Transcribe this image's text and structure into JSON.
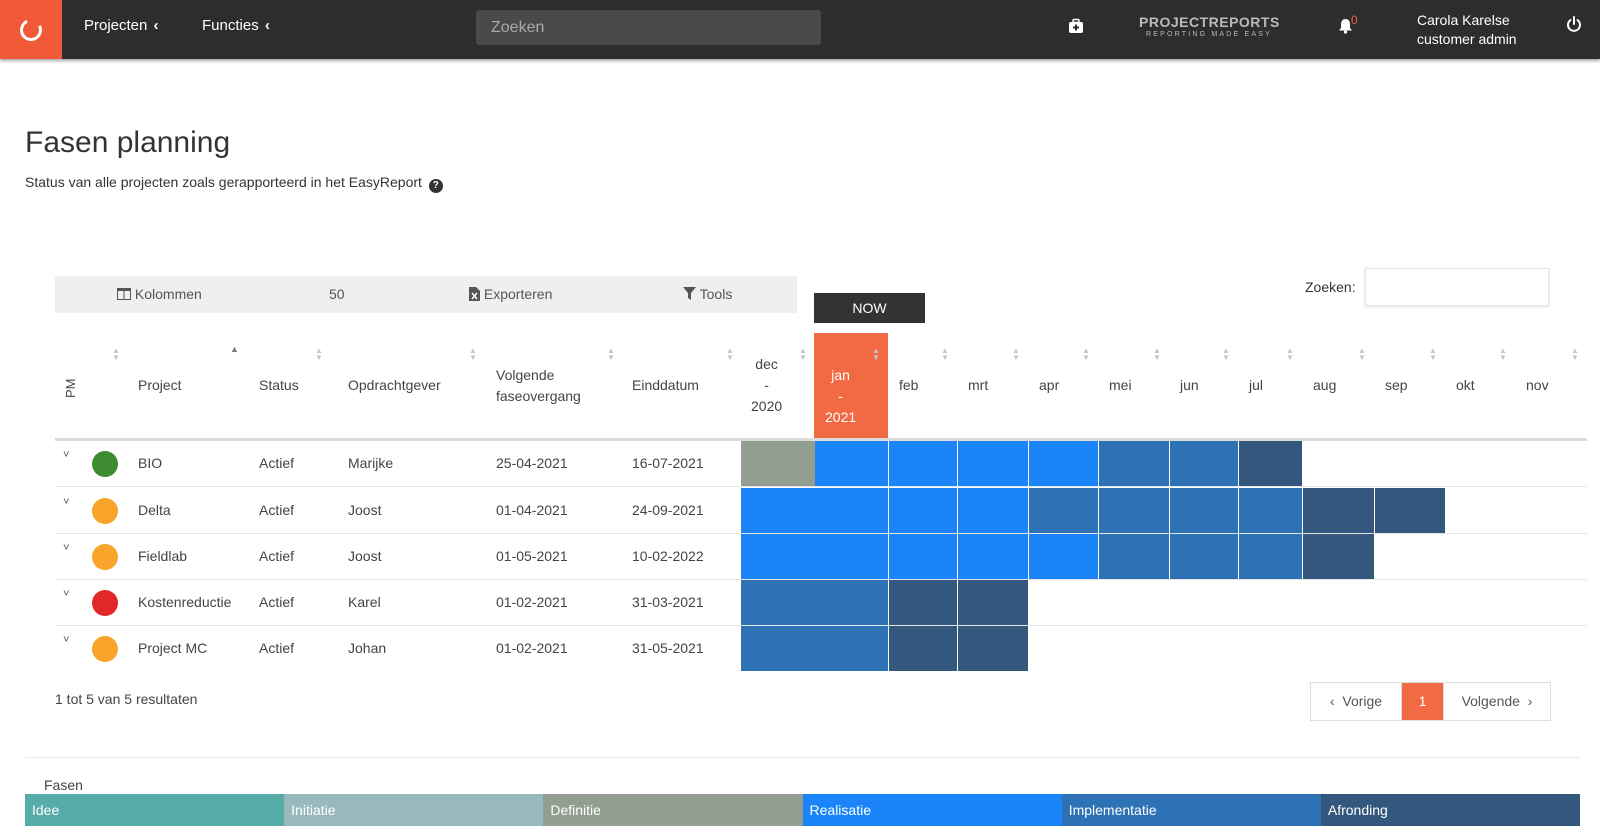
{
  "nav": {
    "projects": "Projecten",
    "functions": "Functies",
    "chevron": "‹",
    "search_placeholder": "Zoeken",
    "brand_main": "PROJECTREPORTS",
    "brand_sub": "REPORTING MADE EASY",
    "notification_count": "0",
    "user_name": "Carola Karelse",
    "user_role": "customer admin"
  },
  "page": {
    "title": "Fasen planning",
    "subtitle": "Status van alle projecten zoals gerapporteerd in het EasyReport"
  },
  "toolbar": {
    "columns": "Kolommen",
    "page_length": "50",
    "export": "Exporteren",
    "tools": "Tools"
  },
  "now_label": "NOW",
  "search_label": "Zoeken:",
  "table": {
    "headers": {
      "pm": "PM",
      "project": "Project",
      "status": "Status",
      "client": "Opdrachtgever",
      "next_transition": "Volgende faseovergang",
      "end_date": "Einddatum"
    },
    "months": [
      "dec - 2020",
      "jan - 2021",
      "feb",
      "mrt",
      "apr",
      "mei",
      "jun",
      "jul",
      "aug",
      "sep",
      "okt",
      "nov"
    ],
    "rows": [
      {
        "pm_color": "#3d8a30",
        "project": "BIO",
        "status": "Actief",
        "client": "Marijke",
        "next": "25-04-2021",
        "end": "16-07-2021",
        "phases": [
          "Definitie",
          "Realisatie",
          "Realisatie",
          "Realisatie",
          "Realisatie",
          "Implementatie",
          "Implementatie",
          "Afronding",
          "",
          "",
          "",
          ""
        ]
      },
      {
        "pm_color": "#f9a42a",
        "project": "Delta",
        "status": "Actief",
        "client": "Joost",
        "next": "01-04-2021",
        "end": "24-09-2021",
        "phases": [
          "Realisatie",
          "Realisatie",
          "Realisatie",
          "Realisatie",
          "Implementatie",
          "Implementatie",
          "Implementatie",
          "Implementatie",
          "Afronding",
          "Afronding",
          "",
          ""
        ]
      },
      {
        "pm_color": "#f9a42a",
        "project": "Fieldlab",
        "status": "Actief",
        "client": "Joost",
        "next": "01-05-2021",
        "end": "10-02-2022",
        "phases": [
          "Realisatie",
          "Realisatie",
          "Realisatie",
          "Realisatie",
          "Realisatie",
          "Implementatie",
          "Implementatie",
          "Implementatie",
          "Afronding",
          "",
          "",
          ""
        ]
      },
      {
        "pm_color": "#e02828",
        "project": "Kostenreductie",
        "status": "Actief",
        "client": "Karel",
        "next": "01-02-2021",
        "end": "31-03-2021",
        "phases": [
          "Implementatie",
          "Implementatie",
          "Afronding",
          "Afronding",
          "",
          "",
          "",
          "",
          "",
          "",
          "",
          ""
        ]
      },
      {
        "pm_color": "#f9a42a",
        "project": "Project MC",
        "status": "Actief",
        "client": "Johan",
        "next": "01-02-2021",
        "end": "31-05-2021",
        "phases": [
          "Implementatie",
          "Implementatie",
          "Afronding",
          "Afronding",
          "",
          "",
          "",
          "",
          "",
          "",
          "",
          ""
        ]
      }
    ]
  },
  "results": "1 tot 5 van 5 resultaten",
  "pager": {
    "prev": "Vorige",
    "current": "1",
    "next": "Volgende"
  },
  "legend": {
    "title": "Fasen",
    "phases": [
      {
        "name": "Idee",
        "color": "#55aca8"
      },
      {
        "name": "Initiatie",
        "color": "#97b9bd"
      },
      {
        "name": "Definitie",
        "color": "#929e90"
      },
      {
        "name": "Realisatie",
        "color": "#1a84f8"
      },
      {
        "name": "Implementatie",
        "color": "#2c72b5"
      },
      {
        "name": "Afronding",
        "color": "#34587d"
      }
    ]
  }
}
